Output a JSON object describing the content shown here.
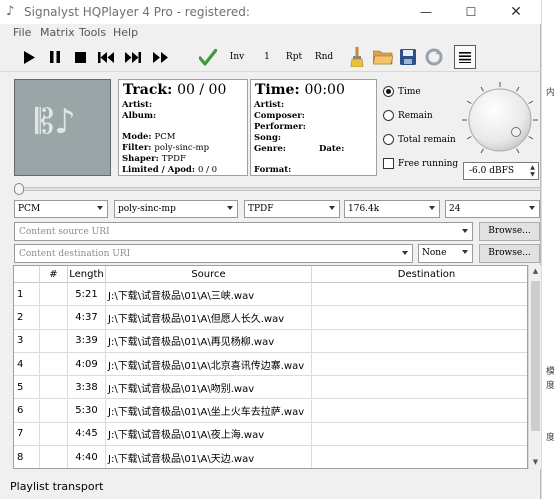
{
  "window": {
    "title": "Signalyst HQPlayer 4 Pro - registered:",
    "minimize_glyph": "—",
    "maximize_glyph": "☐",
    "close_glyph": "✕"
  },
  "menu": [
    "File",
    "Matrix",
    "Tools",
    "Help"
  ],
  "toolbar": {
    "inv_label": "Inv",
    "one_label": "1",
    "rpt_label": "Rpt",
    "rnd_label": "Rnd",
    "icons": [
      "play-icon",
      "pause-icon",
      "stop-icon",
      "previous-icon",
      "next-icon",
      "fast-forward-icon",
      "check-icon",
      "brush-icon",
      "folder-icon",
      "save-icon",
      "refresh-icon",
      "playlist-icon"
    ]
  },
  "track_panel": {
    "track_label": "Track:",
    "track_value": "00 / 00",
    "artist_label": "Artist:",
    "album_label": "Album:",
    "mode_label": "Mode:",
    "mode_value": "PCM",
    "filter_label": "Filter:",
    "filter_value": "poly-sinc-mp",
    "shaper_label": "Shaper:",
    "shaper_value": "TPDF",
    "limited_label": "Limited / Apod:",
    "limited_value": "0 / 0"
  },
  "time_panel": {
    "time_label": "Time:",
    "time_value": "00:00",
    "artist_label": "Artist:",
    "composer_label": "Composer:",
    "performer_label": "Performer:",
    "song_label": "Song:",
    "genre_label": "Genre:",
    "date_label": "Date:",
    "format_label": "Format:"
  },
  "display_options": {
    "time_label": "Time",
    "remain_label": "Remain",
    "total_remain_label": "Total remain",
    "free_running_label": "Free running",
    "selected": "Time"
  },
  "volume": {
    "value": "-6.0 dBFS"
  },
  "selectors": {
    "mode": "PCM",
    "filter": "poly-sinc-mp",
    "shaper": "TPDF",
    "rate": "176.4k",
    "bits": "24",
    "dither": "None"
  },
  "uri": {
    "source_placeholder": "Content source URI",
    "destination_placeholder": "Content destination URI",
    "browse_label": "Browse..."
  },
  "playlist": {
    "columns": [
      "#",
      "Length",
      "Source",
      "Destination"
    ],
    "rows": [
      {
        "num": "1",
        "length": "5:21",
        "source": "J:\\下载\\试音极品\\01\\A\\三峡.wav",
        "destination": ""
      },
      {
        "num": "2",
        "length": "4:37",
        "source": "J:\\下载\\试音极品\\01\\A\\但愿人长久.wav",
        "destination": ""
      },
      {
        "num": "3",
        "length": "3:39",
        "source": "J:\\下载\\试音极品\\01\\A\\再见杨柳.wav",
        "destination": ""
      },
      {
        "num": "4",
        "length": "4:09",
        "source": "J:\\下载\\试音极品\\01\\A\\北京喜讯传边寨.wav",
        "destination": ""
      },
      {
        "num": "5",
        "length": "3:38",
        "source": "J:\\下载\\试音极品\\01\\A\\吻别.wav",
        "destination": ""
      },
      {
        "num": "6",
        "length": "5:30",
        "source": "J:\\下载\\试音极品\\01\\A\\坐上火车去拉萨.wav",
        "destination": ""
      },
      {
        "num": "7",
        "length": "4:45",
        "source": "J:\\下载\\试音极品\\01\\A\\夜上海.wav",
        "destination": ""
      },
      {
        "num": "8",
        "length": "4:40",
        "source": "J:\\下载\\试音极品\\01\\A\\天边.wav",
        "destination": ""
      }
    ]
  },
  "status": {
    "text": "Playlist transport"
  },
  "background_window": {
    "chars": [
      "内",
      "模",
      "度",
      "度"
    ]
  }
}
